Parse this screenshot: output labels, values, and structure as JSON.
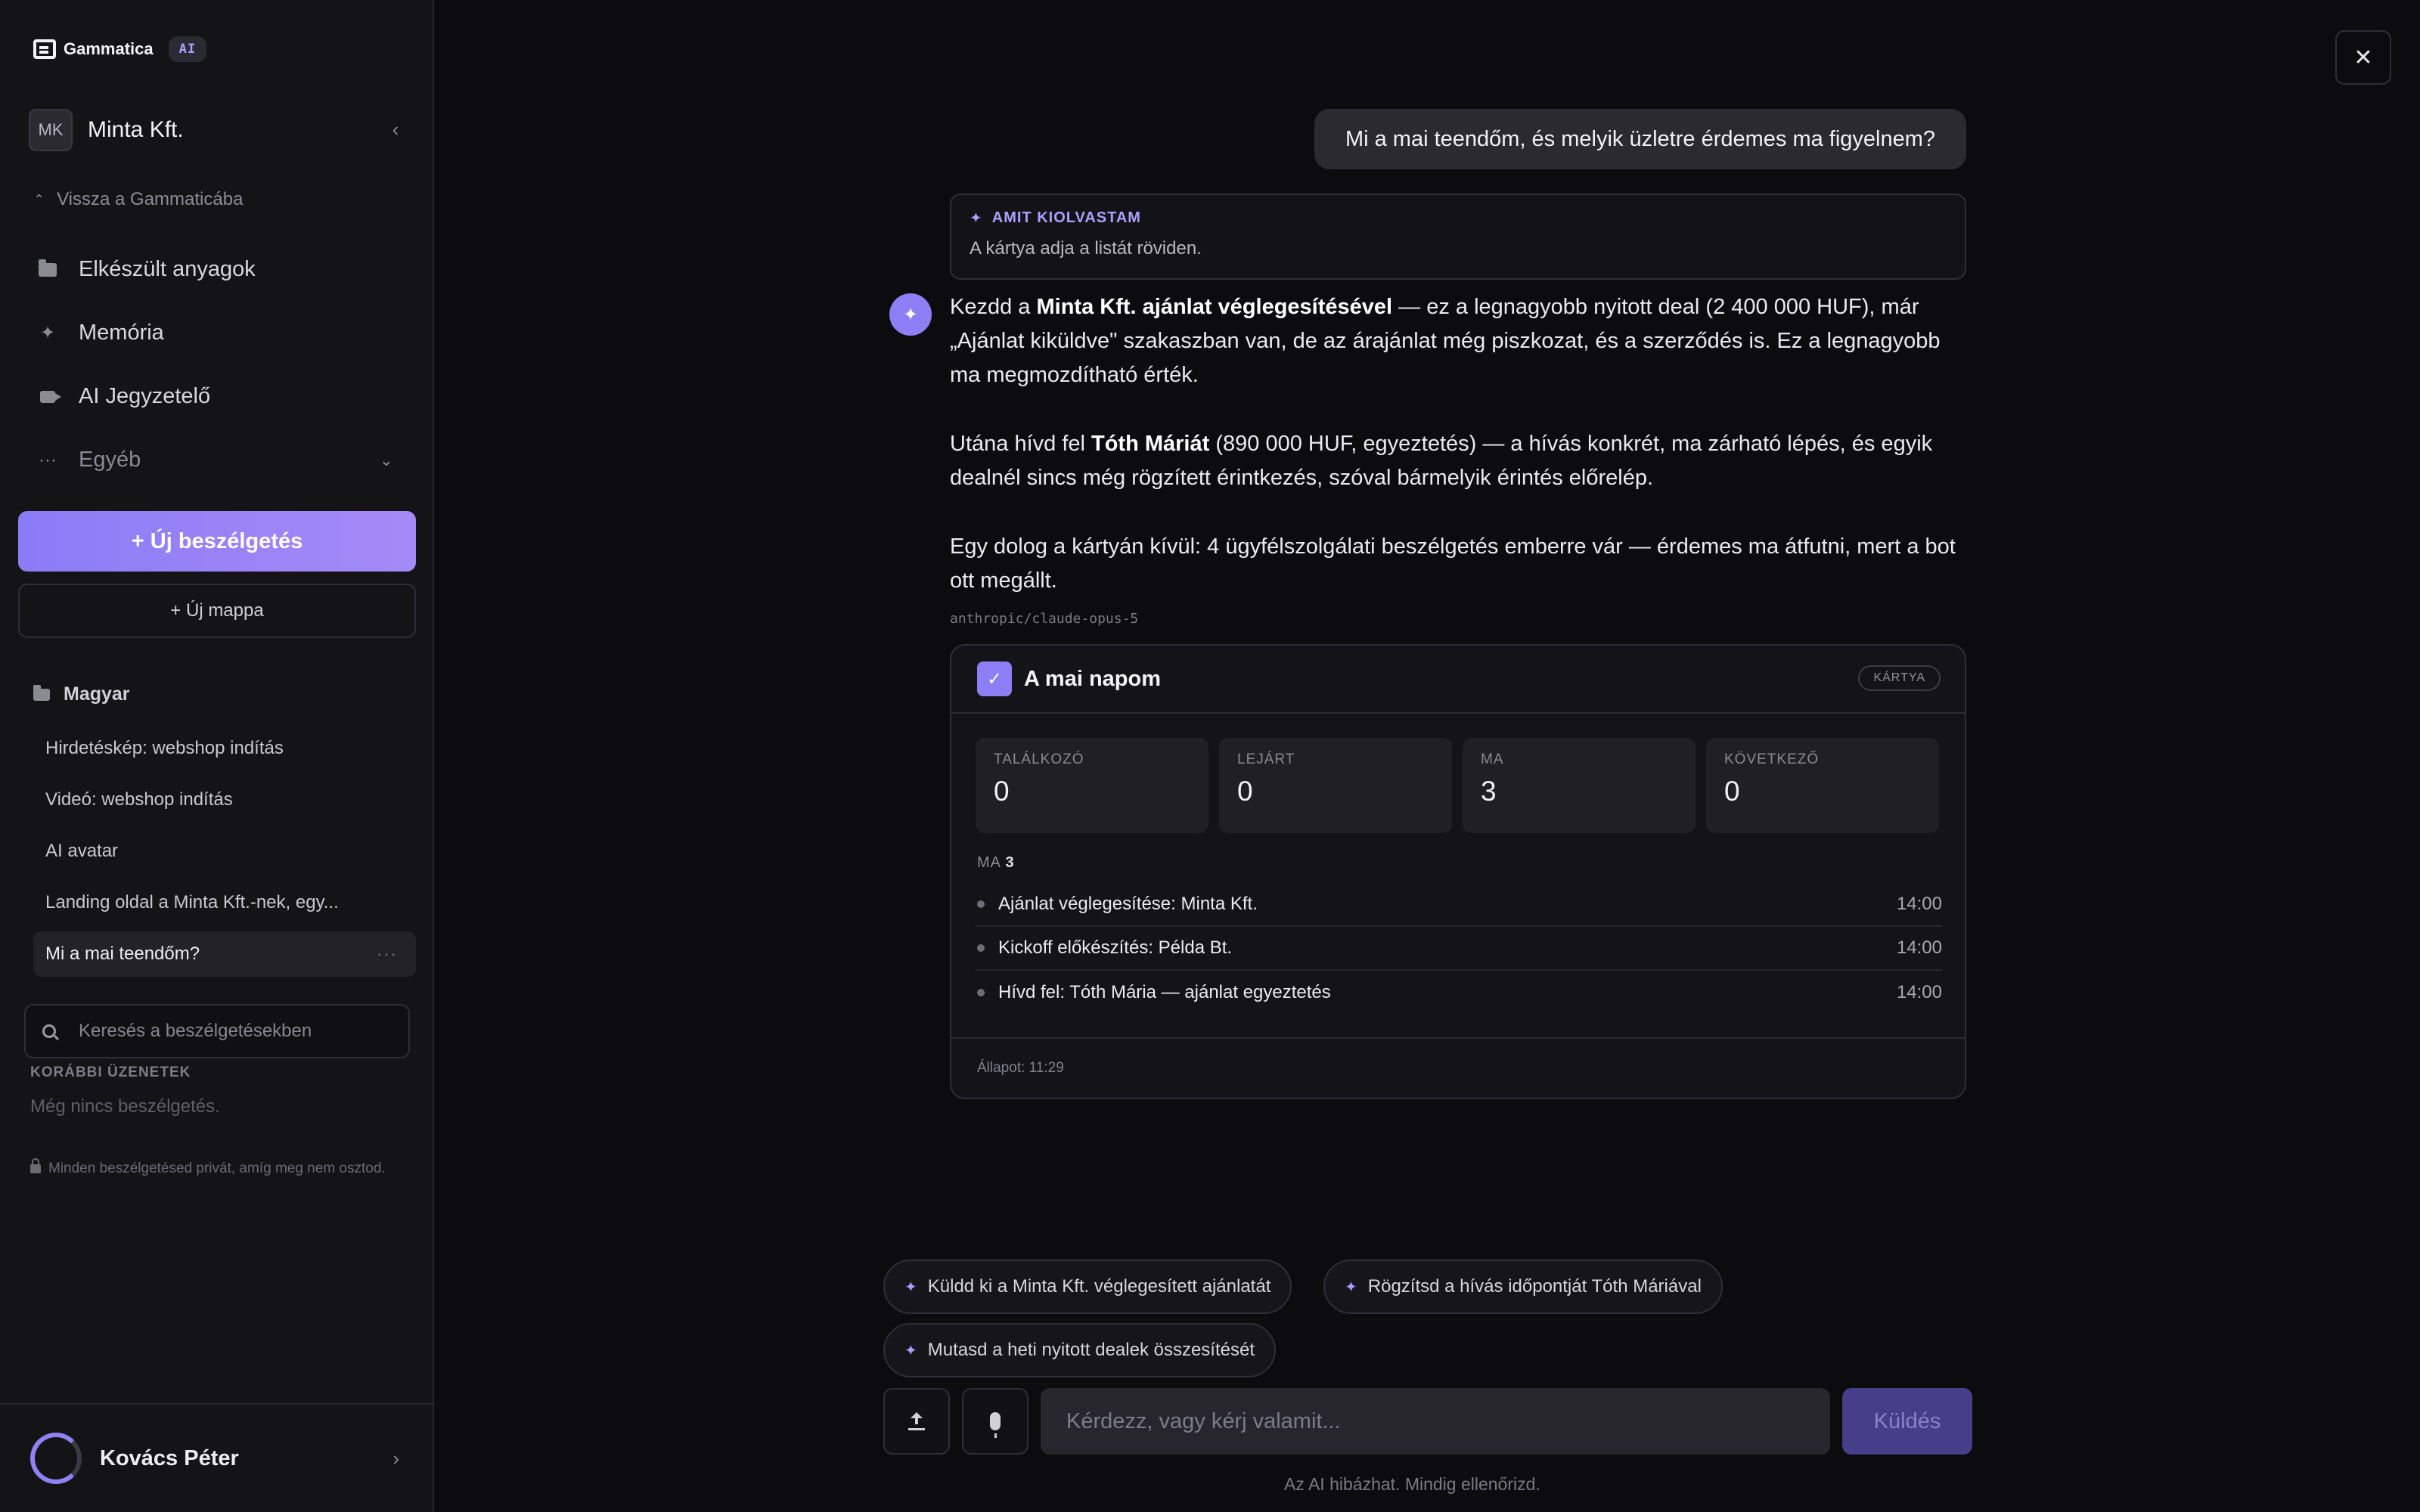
{
  "app": {
    "brand": "Gammatica",
    "ai_badge": "AI"
  },
  "sidebar": {
    "org_initials": "MK",
    "org_name": "Minta Kft.",
    "collapse_glyph": "‹",
    "back_link": "Vissza a Gammaticába",
    "nav": [
      {
        "label": "Elkészült anyagok",
        "icon": "folder-icon"
      },
      {
        "label": "Memória",
        "icon": "sparkle-icon"
      },
      {
        "label": "AI Jegyzetelő",
        "icon": "camera-icon"
      },
      {
        "label": "Egyéb",
        "icon": "more-icon"
      }
    ],
    "new_chat": "+ Új beszélgetés",
    "new_folder": "+ Új mappa",
    "folder_name": "Magyar",
    "conversations": [
      "Hirdetéskép: webshop indítás",
      "Videó: webshop indítás",
      "AI avatar",
      "Landing oldal a Minta Kft.-nek, egy...",
      "Mi a mai teendőm?"
    ],
    "search_placeholder": "Keresés a beszélgetésekben",
    "older_label": "KORÁBBI ÜZENETEK",
    "older_empty": "Még nincs beszélgetés.",
    "privacy_note": "Minden beszélgetésed privát, amíg meg nem osztod.",
    "user_name": "Kovács Péter"
  },
  "chat": {
    "user_message": "Mi a mai teendőm, és melyik üzletre érdemes ma figyelnem?",
    "read_box": {
      "title": "AMIT KIOLVASTAM",
      "text": "A kártya adja a listát röviden."
    },
    "answer": {
      "p1_a": "Kezdd a ",
      "p1_b": "Minta Kft. ajánlat véglegesítésével",
      "p1_c": " — ez a legnagyobb nyitott deal (2 400 000 HUF), már „Ajánlat kiküldve\" szakaszban van, de az árajánlat még piszkozat, és a szerződés is. Ez a legnagyobb ma megmozdítható érték.",
      "p2_a": "Utána hívd fel ",
      "p2_b": "Tóth Máriát",
      "p2_c": " (890 000 HUF, egyeztetés) — a hívás konkrét, ma zárható lépés, és egyik dealnél sincs még rögzített érintkezés, szóval bármelyik érintés előrelép.",
      "p3": "Egy dolog a kártyán kívül: 4 ügyfélszolgálati beszélgetés emberre vár — érdemes ma átfutni, mert a bot ott megállt."
    },
    "model": "anthropic/claude-opus-5",
    "card": {
      "title": "A mai napom",
      "badge": "KÁRTYA",
      "stats": [
        {
          "label": "TALÁLKOZÓ",
          "value": "0"
        },
        {
          "label": "LEJÁRT",
          "value": "0"
        },
        {
          "label": "MA",
          "value": "3"
        },
        {
          "label": "KÖVETKEZŐ",
          "value": "0"
        }
      ],
      "today_label": "MA",
      "today_count": "3",
      "tasks": [
        {
          "title": "Ajánlat véglegesítése: Minta Kft.",
          "time": "14:00"
        },
        {
          "title": "Kickoff előkészítés: Példa Bt.",
          "time": "14:00"
        },
        {
          "title": "Hívd fel: Tóth Mária — ajánlat egyeztetés",
          "time": "14:00"
        }
      ],
      "footer": "Állapot: 11:29"
    },
    "suggestions": [
      "Küldd ki a Minta Kft. véglegesített ajánlatát",
      "Rögzítsd a hívás időpontját Tóth Máriával",
      "Mutasd a heti nyitott dealek összesítését"
    ],
    "composer_placeholder": "Kérdezz, vagy kérj valamit...",
    "send": "Küldés",
    "disclaimer": "Az AI hibázhat. Mindig ellenőrizd."
  },
  "colors": {
    "accent": "#8c7ef5",
    "background": "#0c0c0f",
    "sidebar": "#141417"
  }
}
